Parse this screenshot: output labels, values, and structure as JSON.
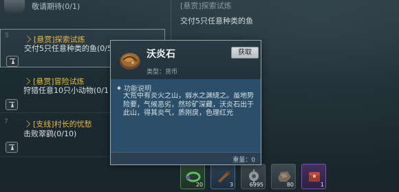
{
  "top_bar": {
    "text": "敬请期待(0/1)"
  },
  "quests": [
    {
      "number": "5",
      "title": "[悬赏]探索试炼",
      "desc": "交付5只任意种类的鱼(0/5)"
    },
    {
      "number": "",
      "title": "[悬赏]冒险试炼",
      "desc": "狩猎任意10只小动物(0/1"
    },
    {
      "number": "7",
      "title": "[支线]村长的忧愁",
      "desc": "击败翠鹞(0/10)"
    }
  ],
  "detail": {
    "header": "[悬赏]探索试炼",
    "description": "交付5只任意种类的鱼"
  },
  "popup": {
    "item_name": "沃炎石",
    "type_label": "类型：货币",
    "get_label": "获取",
    "section_title": "功能说明",
    "section_text": "大荒中有炎火之山，弱水之渊绕之。虽地势险要，气候恶劣，然珍矿深藏，沃炎石出于此山，得其炎气，质刚戾，色理红光",
    "weight": "重量：0"
  },
  "items": [
    {
      "icon": "green-ring-icon",
      "count": "20",
      "rarity": "#4d8d5a"
    },
    {
      "icon": "wood-club-icon",
      "count": "3",
      "rarity": "#3c6f9a"
    },
    {
      "icon": "gear-ore-icon",
      "count": "6995",
      "rarity": "#4b5960"
    },
    {
      "icon": "stone-icon",
      "count": "80",
      "rarity": "#4b5960"
    },
    {
      "icon": "purple-chest-icon",
      "count": "1",
      "rarity": "#7c4fb4"
    }
  ],
  "colors": {
    "quest_title": "#e6b840",
    "popup_body": "#2b4f6b"
  }
}
